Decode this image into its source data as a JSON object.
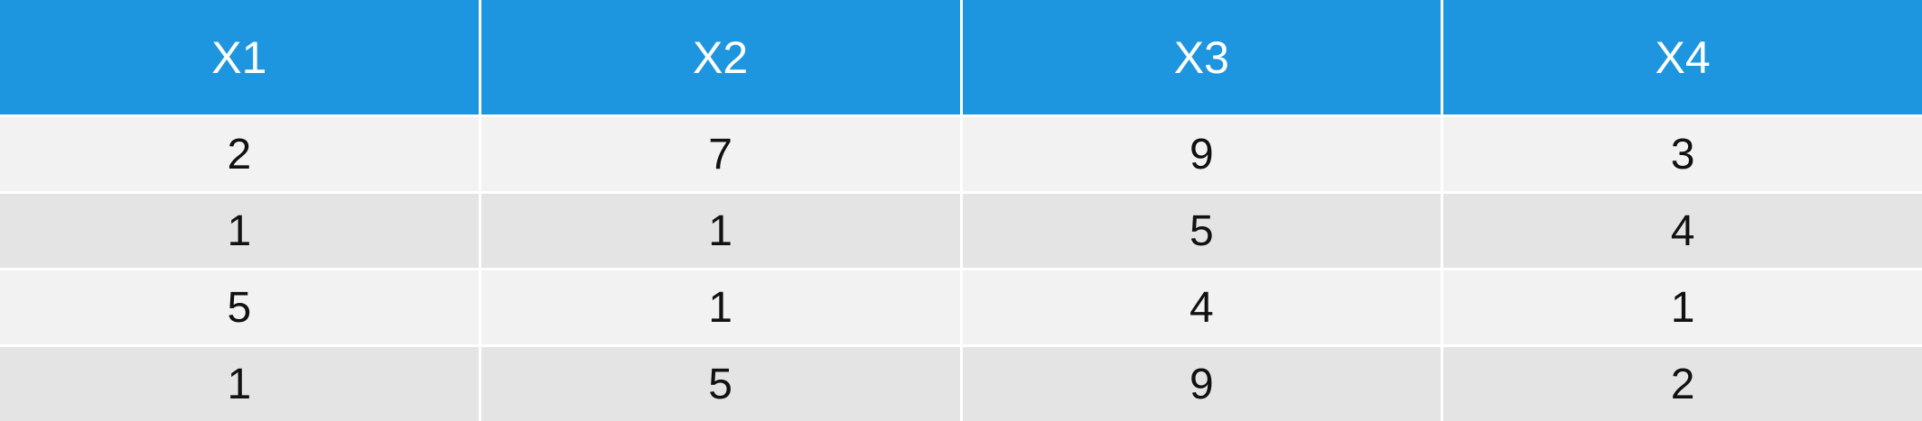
{
  "table": {
    "headers": [
      "X1",
      "X2",
      "X3",
      "X4"
    ],
    "rows": [
      [
        "2",
        "7",
        "9",
        "3"
      ],
      [
        "1",
        "1",
        "5",
        "4"
      ],
      [
        "5",
        "1",
        "4",
        "1"
      ],
      [
        "1",
        "5",
        "9",
        "2"
      ]
    ]
  },
  "colors": {
    "header_background": "#1e96df",
    "header_text": "#ffffff",
    "row_light": "#f2f2f2",
    "row_dark": "#e4e4e4",
    "cell_text": "#111111"
  }
}
